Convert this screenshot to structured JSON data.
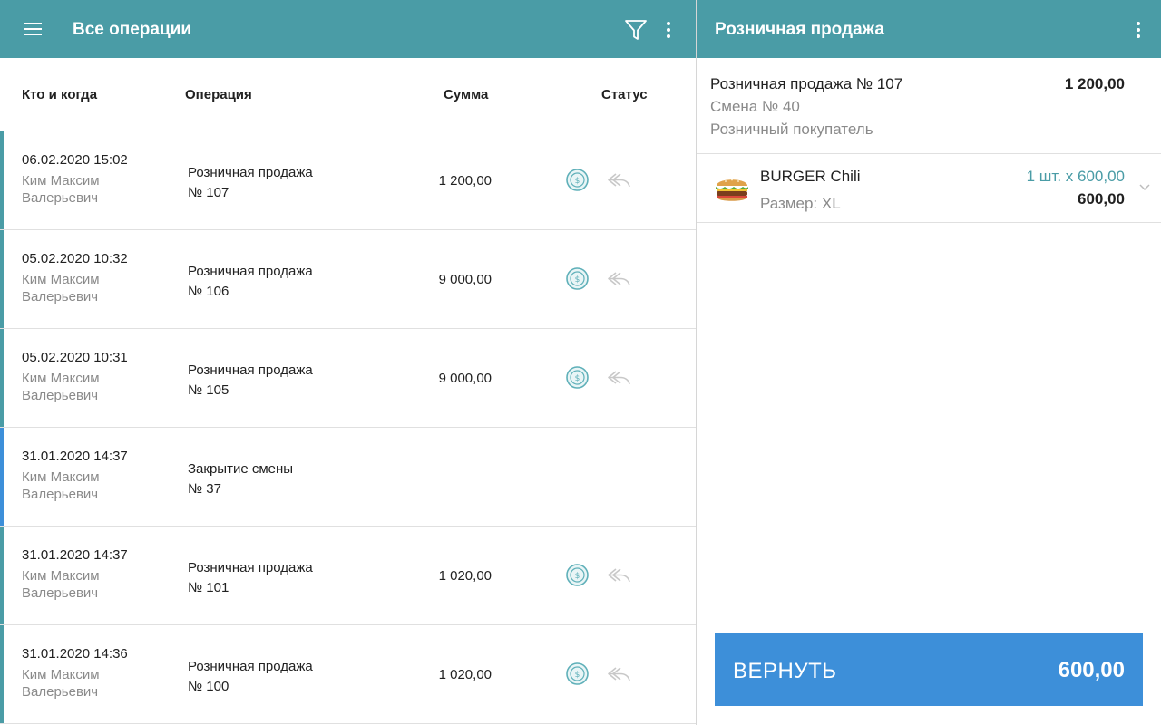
{
  "left_header": {
    "title": "Все операции",
    "icons": [
      "menu-icon",
      "filter-icon",
      "more-vert-icon"
    ]
  },
  "table": {
    "columns": {
      "who": "Кто и когда",
      "operation": "Операция",
      "sum": "Сумма",
      "status": "Статус"
    },
    "rows": [
      {
        "date": "06.02.2020 15:02",
        "who": "Ким Максим Валерьевич",
        "op_name": "Розничная продажа",
        "op_no": "№ 107",
        "sum": "1 200,00",
        "bar_color": "#4a9ca6",
        "status_icons": [
          "coin-icon",
          "undo-icon"
        ]
      },
      {
        "date": "05.02.2020 10:32",
        "who": "Ким Максим Валерьевич",
        "op_name": "Розничная продажа",
        "op_no": "№ 106",
        "sum": "9 000,00",
        "bar_color": "#4a9ca6",
        "status_icons": [
          "coin-icon",
          "undo-icon"
        ]
      },
      {
        "date": "05.02.2020 10:31",
        "who": "Ким Максим Валерьевич",
        "op_name": "Розничная продажа",
        "op_no": "№ 105",
        "sum": "9 000,00",
        "bar_color": "#4a9ca6",
        "status_icons": [
          "coin-icon",
          "undo-icon"
        ]
      },
      {
        "date": "31.01.2020 14:37",
        "who": "Ким Максим Валерьевич",
        "op_name": "Закрытие смены",
        "op_no": "№ 37",
        "sum": "",
        "bar_color": "#3d8fd9",
        "status_icons": []
      },
      {
        "date": "31.01.2020 14:37",
        "who": "Ким Максим Валерьевич",
        "op_name": "Розничная продажа",
        "op_no": "№ 101",
        "sum": "1 020,00",
        "bar_color": "#4a9ca6",
        "status_icons": [
          "coin-icon",
          "undo-icon"
        ]
      },
      {
        "date": "31.01.2020 14:36",
        "who": "Ким Максим Валерьевич",
        "op_name": "Розничная продажа",
        "op_no": "№ 100",
        "sum": "1 020,00",
        "bar_color": "#4a9ca6",
        "status_icons": [
          "coin-icon",
          "undo-icon"
        ]
      }
    ]
  },
  "right_header": {
    "title": "Розничная продажа",
    "icons": [
      "more-vert-icon"
    ]
  },
  "detail": {
    "title": "Розничная продажа № 107",
    "total": "1 200,00",
    "shift": "Смена № 40",
    "customer": "Розничный покупатель",
    "items": [
      {
        "name": "BURGER Chili",
        "size": "Размер: XL",
        "qty": "1 шт. x 600,00",
        "amount": "600,00",
        "icon": "burger-icon"
      }
    ]
  },
  "return_button": {
    "label": "ВЕРНУТЬ",
    "amount": "600,00"
  },
  "colors": {
    "accent": "#4a9ca6",
    "button": "#3d8fd9",
    "close_shift_bar": "#3d8fd9"
  }
}
